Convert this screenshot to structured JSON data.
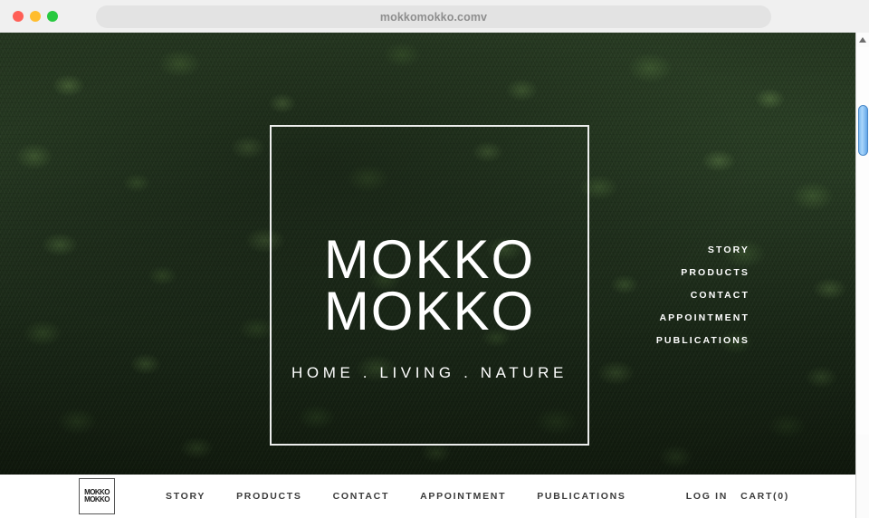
{
  "browser": {
    "url": "mokkomokko.comv",
    "traffic_lights": [
      {
        "name": "close",
        "color": "#ff5f56"
      },
      {
        "name": "minimize",
        "color": "#ffbd2e"
      },
      {
        "name": "maximize",
        "color": "#27c93f"
      }
    ]
  },
  "hero": {
    "background_image": "aerial-forest-canopy-photo",
    "background_colors": [
      "#2e4428",
      "#243620",
      "#152111"
    ],
    "logo": {
      "line1": "MOKKO",
      "line2": "MOKKO",
      "tagline": "HOME . LIVING . NATURE",
      "frame_color": "#ffffff"
    },
    "side_nav": [
      {
        "label": "STORY"
      },
      {
        "label": "PRODUCTS"
      },
      {
        "label": "CONTACT"
      },
      {
        "label": "APPOINTMENT"
      },
      {
        "label": "PUBLICATIONS"
      }
    ]
  },
  "footer": {
    "logo": {
      "line1": "MOKKO",
      "line2": "MOKKO"
    },
    "nav": [
      {
        "label": "STORY"
      },
      {
        "label": "PRODUCTS"
      },
      {
        "label": "CONTACT"
      },
      {
        "label": "APPOINTMENT"
      },
      {
        "label": "PUBLICATIONS"
      }
    ],
    "account": {
      "login_label": "LOG IN",
      "cart_label": "CART(0)"
    }
  },
  "scrollbar": {
    "thumb_color": "#7cb9f0",
    "has_up_arrow": true
  }
}
